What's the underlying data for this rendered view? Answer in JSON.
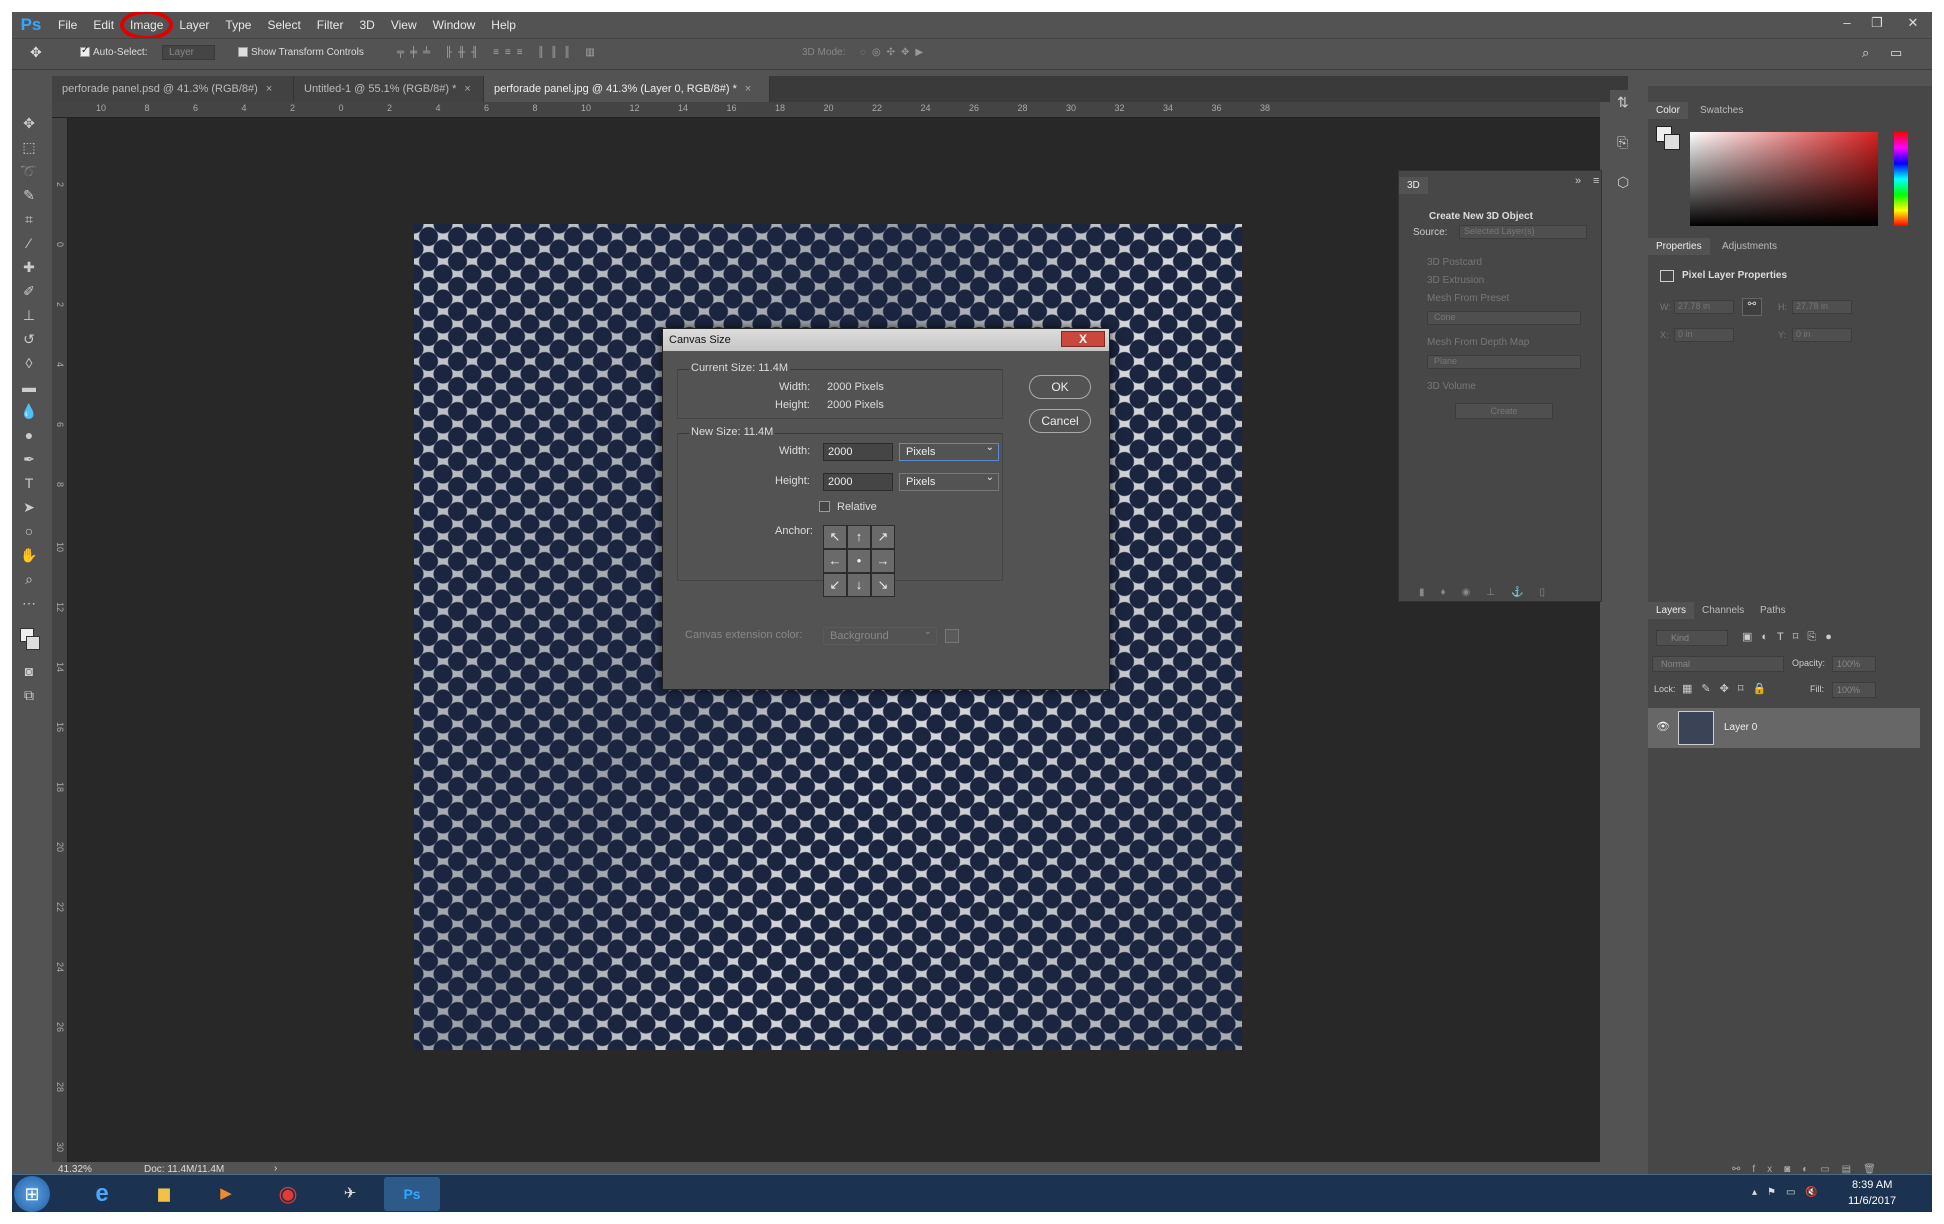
{
  "app": {
    "logo": "Ps"
  },
  "menu": [
    "File",
    "Edit",
    "Image",
    "Layer",
    "Type",
    "Select",
    "Filter",
    "3D",
    "View",
    "Window",
    "Help"
  ],
  "window_controls": {
    "minimize": "–",
    "restore": "❐",
    "close": "✕"
  },
  "options_bar": {
    "auto_select_label": "Auto-Select:",
    "auto_select_value": "Layer",
    "show_transform_label": "Show Transform Controls",
    "mode_3d_label": "3D Mode:"
  },
  "tabs": [
    {
      "label": "perforade panel.psd @ 41.3% (RGB/8#)",
      "close": "×"
    },
    {
      "label": "Untitled-1 @ 55.1% (RGB/8#) *",
      "close": "×"
    },
    {
      "label": "perforade panel.jpg @ 41.3% (Layer 0, RGB/8#) *",
      "close": "×"
    }
  ],
  "ruler_top": [
    "10",
    "8",
    "6",
    "4",
    "2",
    "0",
    "2",
    "4",
    "6",
    "8",
    "10",
    "12",
    "14",
    "16",
    "18",
    "20",
    "22",
    "24",
    "26",
    "28",
    "30",
    "32",
    "34",
    "36",
    "38"
  ],
  "ruler_left": [
    "2",
    "0",
    "2",
    "4",
    "6",
    "8",
    "10",
    "12",
    "14",
    "16",
    "18",
    "20",
    "22",
    "24",
    "26",
    "28",
    "30"
  ],
  "status": {
    "zoom": "41.32%",
    "doc": "Doc: 11.4M/11.4M",
    "arrow": "›"
  },
  "dialog": {
    "title": "Canvas Size",
    "close": "X",
    "current_size": "Current Size: 11.4M",
    "width_label": "Width:",
    "height_label": "Height:",
    "current_width": "2000 Pixels",
    "current_height": "2000 Pixels",
    "new_size": "New Size: 11.4M",
    "new_width": "2000",
    "new_height": "2000",
    "unit_width": "Pixels",
    "unit_height": "Pixels",
    "relative_label": "Relative",
    "anchor_label": "Anchor:",
    "anchor_arrows": [
      "↖",
      "↑",
      "↗",
      "←",
      "•",
      "→",
      "↙",
      "↓",
      "↘"
    ],
    "ext_color_label": "Canvas extension color:",
    "ext_color_value": "Background",
    "ok": "OK",
    "cancel": "Cancel"
  },
  "panel_3d": {
    "tab": "3D",
    "expand": "»",
    "heading": "Create New 3D Object",
    "source_label": "Source:",
    "source_value": "Selected Layer(s)",
    "options": [
      "3D Postcard",
      "3D Extrusion",
      "Mesh From Preset",
      "Mesh From Depth Map",
      "3D Volume"
    ],
    "preset_value": "Cone",
    "depth_value": "Plane",
    "create": "Create"
  },
  "color_panel": {
    "tabs": [
      "Color",
      "Swatches"
    ]
  },
  "properties_panel": {
    "tabs": [
      "Properties",
      "Adjustments"
    ],
    "heading": "Pixel Layer Properties",
    "w_label": "W:",
    "w_value": "27.78 in",
    "h_label": "H:",
    "h_value": "27.78 in",
    "x_label": "X:",
    "x_value": "0 in",
    "y_label": "Y:",
    "y_value": "0 in"
  },
  "layers_panel": {
    "tabs": [
      "Layers",
      "Channels",
      "Paths"
    ],
    "kind": "Kind",
    "blend": "Normal",
    "opacity_label": "Opacity:",
    "opacity_value": "100%",
    "lock_label": "Lock:",
    "fill_label": "Fill:",
    "fill_value": "100%",
    "layer_name": "Layer 0"
  },
  "taskbar": {
    "time": "8:39 AM",
    "date": "11/6/2017"
  },
  "colors": {
    "accent": "#31a8ff",
    "highlight": "#e00000"
  }
}
